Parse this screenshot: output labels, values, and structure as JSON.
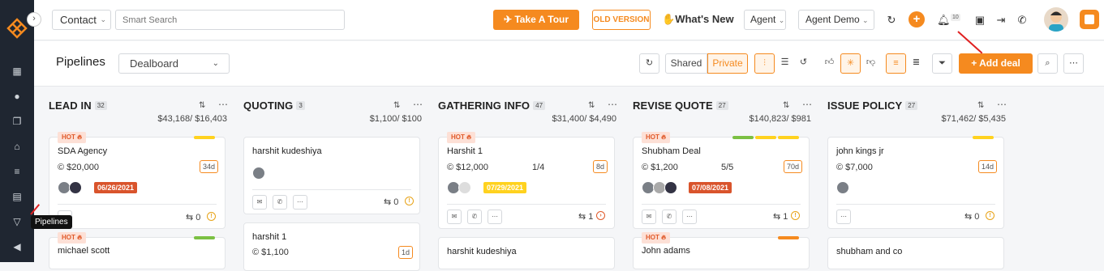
{
  "topbar": {
    "module_select": "Contact",
    "search_placeholder": "Smart Search",
    "tour_label": "Take A Tour",
    "old_version_label": "OLD VERSION",
    "whats_new_label": "What's New",
    "agent_label": "Agent",
    "agent_demo_label": "Agent Demo",
    "notification_count": "10"
  },
  "sidebar": {
    "tooltip": "Pipelines"
  },
  "toolbar": {
    "title": "Pipelines",
    "board_select": "Dealboard",
    "shared_label": "Shared",
    "private_label": "Private",
    "add_deal_label": "Add deal"
  },
  "columns": [
    {
      "name": "LEAD IN",
      "count": "32",
      "amount": "$43,168/ $16,403"
    },
    {
      "name": "QUOTING",
      "count": "3",
      "amount": "$1,100/ $100"
    },
    {
      "name": "GATHERING INFO",
      "count": "47",
      "amount": "$31,400/ $4,490"
    },
    {
      "name": "REVISE QUOTE",
      "count": "27",
      "amount": "$140,823/ $981"
    },
    {
      "name": "ISSUE POLICY",
      "count": "27",
      "amount": "$71,462/ $5,435"
    }
  ],
  "cards": {
    "c1": {
      "hot": "HOT",
      "title": "SDA Agency",
      "amount": "$20,000",
      "days": "34d",
      "date": "06/26/2021",
      "activity": "0"
    },
    "c2": {
      "hot": "HOT",
      "title": "michael scott"
    },
    "c3": {
      "title": "harshit kudeshiya",
      "activity": "0"
    },
    "c4": {
      "title": "harshit 1",
      "amount": "$1,100",
      "days": "1d"
    },
    "c5": {
      "hot": "HOT",
      "title": "Harshit 1",
      "amount": "$12,000",
      "ratio": "1/4",
      "days": "8d",
      "date": "07/29/2021",
      "activity": "1"
    },
    "c6": {
      "title": "harshit kudeshiya"
    },
    "c7": {
      "hot": "HOT",
      "title": "Shubham Deal",
      "amount": "$1,200",
      "ratio": "5/5",
      "days": "70d",
      "date": "07/08/2021",
      "activity": "1"
    },
    "c8": {
      "hot": "HOT",
      "title": "John adams"
    },
    "c9": {
      "title": "john kings jr",
      "amount": "$7,000",
      "days": "14d",
      "activity": "0"
    },
    "c10": {
      "title": "shubham and co"
    }
  },
  "colors": {
    "accent": "#f58a1f",
    "sidebar": "#1f2631",
    "hot_bg": "#fde0d6",
    "date_red": "#d9542c",
    "date_yellow": "#ffd21f"
  }
}
